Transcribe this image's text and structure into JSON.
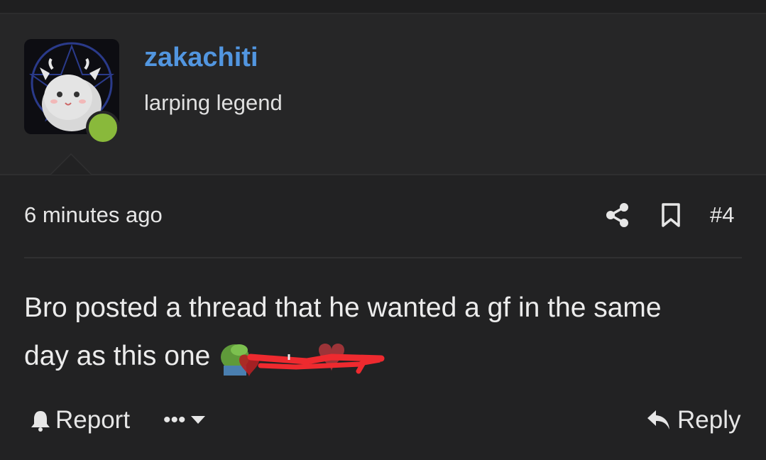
{
  "user": {
    "username": "zakachiti",
    "title": "larping legend",
    "online": true
  },
  "post": {
    "timestamp": "6 minutes ago",
    "number": "#4",
    "body_line1": "Bro posted a thread that he wanted a gf in the same",
    "body_line2": "day as this one"
  },
  "actions": {
    "report_label": "Report",
    "more_label": "•••",
    "reply_label": "Reply"
  },
  "icons": [
    "share-icon",
    "bookmark-icon",
    "bell-icon",
    "chevron-down-icon",
    "reply-icon"
  ],
  "colors": {
    "background": "#222223",
    "user_panel": "#262627",
    "username": "#5296e0",
    "online": "#89b93b",
    "scribble": "#ee2a2f"
  }
}
